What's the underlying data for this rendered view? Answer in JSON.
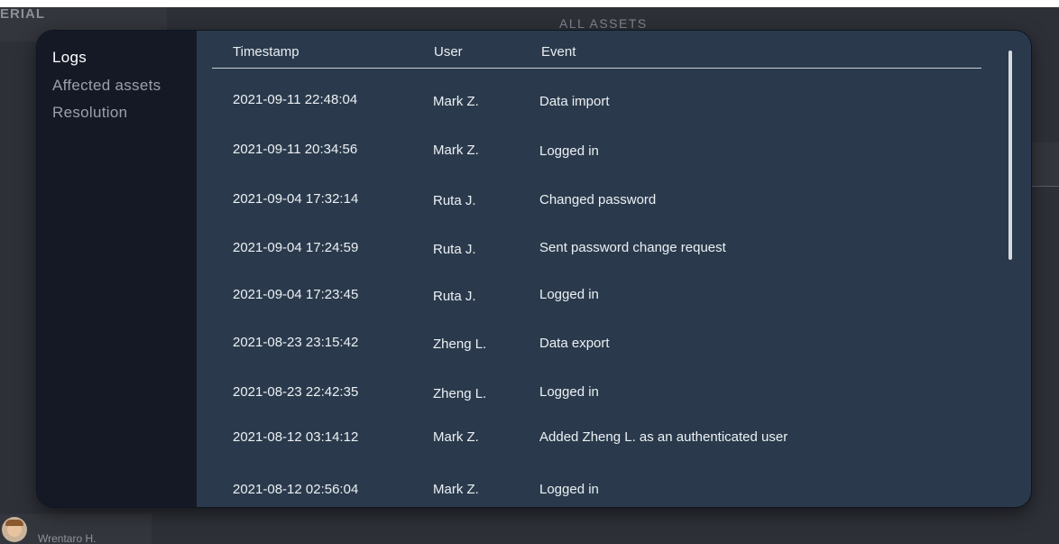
{
  "background": {
    "brand": "ERIAL",
    "heading": "ALL ASSETS",
    "user": {
      "name": "Wrentaro H.",
      "avatar_icon": "user-avatar"
    }
  },
  "modal": {
    "sidebar": {
      "items": [
        {
          "label": "Logs",
          "active": true
        },
        {
          "label": "Affected assets",
          "active": false
        },
        {
          "label": "Resolution",
          "active": false
        }
      ]
    },
    "table": {
      "columns": {
        "timestamp": "Timestamp",
        "user": "User",
        "event": "Event"
      },
      "rows": [
        {
          "timestamp": "2021-09-11 22:48:04",
          "user": "Mark Z.",
          "event": "Data import"
        },
        {
          "timestamp": "2021-09-11 20:34:56",
          "user": "Mark Z.",
          "event": "Logged in"
        },
        {
          "timestamp": "2021-09-04 17:32:14",
          "user": "Ruta J.",
          "event": "Changed password"
        },
        {
          "timestamp": "2021-09-04 17:24:59",
          "user": "Ruta J.",
          "event": "Sent password change request"
        },
        {
          "timestamp": "2021-09-04 17:23:45",
          "user": "Ruta J.",
          "event": "Logged in"
        },
        {
          "timestamp": "2021-08-23 23:15:42",
          "user": "Zheng L.",
          "event": "Data export"
        },
        {
          "timestamp": "2021-08-23 22:42:35",
          "user": "Zheng L.",
          "event": "Logged in"
        },
        {
          "timestamp": "2021-08-12 03:14:12",
          "user": "Mark Z.",
          "event": "Added Zheng L. as an authenticated user"
        },
        {
          "timestamp": "2021-08-12 02:56:04",
          "user": "Mark Z.",
          "event": "Logged in"
        }
      ]
    },
    "scrollbar": {
      "position": 0
    }
  },
  "colors": {
    "modal_sidebar_bg": "#151926",
    "modal_main_bg": "#2a3a4c",
    "text_primary": "#ecf0f4",
    "text_muted": "#9aa0aa"
  }
}
